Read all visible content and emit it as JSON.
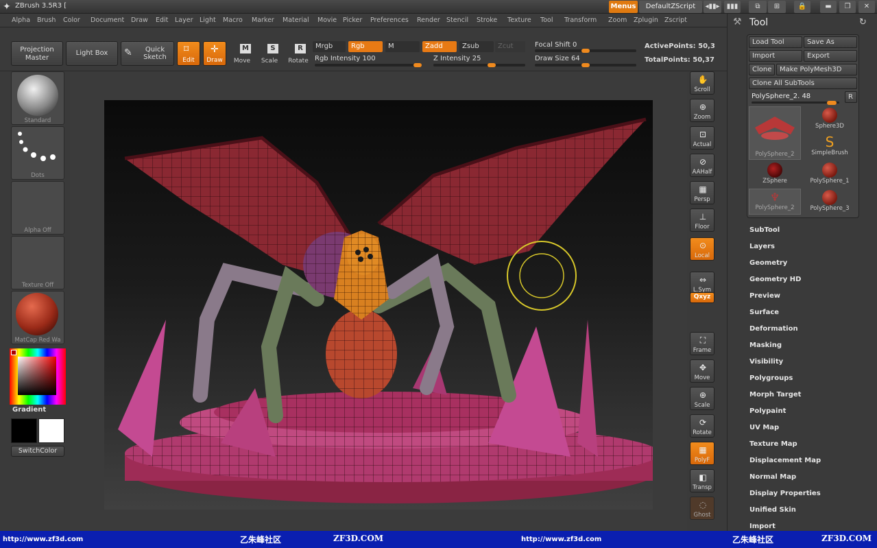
{
  "titlebar": {
    "title": "ZBrush 3.5R3 [",
    "menus_label": "Menus",
    "zscript_label": "DefaultZScript"
  },
  "menubar": {
    "items": [
      "Alpha",
      "Brush",
      "Color",
      "Document",
      "Draw",
      "Edit",
      "Layer",
      "Light",
      "Macro",
      "Marker",
      "Material",
      "Movie",
      "Picker",
      "Preferences",
      "Render",
      "Stencil",
      "Stroke",
      "Texture",
      "Tool",
      "Transform",
      "Zoom",
      "Zplugin",
      "Zscript"
    ]
  },
  "toolbar": {
    "projection_master": "Projection Master",
    "light_box": "Light Box",
    "quick_sketch": "Quick Sketch",
    "edit": "Edit",
    "draw": "Draw",
    "move": "Move",
    "scale": "Scale",
    "rotate": "Rotate",
    "mrgb": "Mrgb",
    "rgb": "Rgb",
    "m": "M",
    "zadd": "Zadd",
    "zsub": "Zsub",
    "zcut": "Zcut",
    "rgb_intensity_label": "Rgb Intensity",
    "rgb_intensity_value": "100",
    "rgb_intensity": 100,
    "z_intensity_label": "Z Intensity",
    "z_intensity_value": "25",
    "z_intensity": 25,
    "focal_shift_label": "Focal Shift",
    "focal_shift_value": "0",
    "draw_size_label": "Draw Size",
    "draw_size_value": "64",
    "active_points": "ActivePoints: 50,3",
    "total_points": "TotalPoints: 50,37"
  },
  "leftshelf": {
    "brush": "Standard",
    "stroke": "Dots",
    "alpha": "Alpha Off",
    "texture": "Texture Off",
    "material": "MatCap Red Wa",
    "gradient": "Gradient",
    "switchcolor": "SwitchColor"
  },
  "rightshelf": {
    "items": [
      {
        "label": "Scroll"
      },
      {
        "label": "Zoom"
      },
      {
        "label": "Actual"
      },
      {
        "label": "AAHalf"
      },
      {
        "label": "Persp"
      },
      {
        "label": "Floor"
      },
      {
        "label": "Local"
      },
      {
        "label": "L.Sym"
      },
      {
        "label": "Frame"
      },
      {
        "label": "Move"
      },
      {
        "label": "Scale"
      },
      {
        "label": "Rotate"
      },
      {
        "label": "PolyF"
      },
      {
        "label": "Transp"
      },
      {
        "label": "Ghost"
      }
    ],
    "xyz": "Qxyz"
  },
  "toolpanel": {
    "title": "Tool",
    "load_tool": "Load Tool",
    "save_as": "Save As",
    "import": "Import",
    "export": "Export",
    "clone": "Clone",
    "make_polymesh": "Make PolyMesh3D",
    "clone_all": "Clone All SubTools",
    "current_tool": "PolySphere_2. 48",
    "r_label": "R",
    "tiles": [
      "PolySphere_2",
      "Sphere3D",
      "SimpleBrush",
      "ZSphere",
      "PolySphere_1",
      "PolySphere_2",
      "PolySphere_3"
    ],
    "subpalettes": [
      "SubTool",
      "Layers",
      "Geometry",
      "Geometry HD",
      "Preview",
      "Surface",
      "Deformation",
      "Masking",
      "Visibility",
      "Polygroups",
      "Morph Target",
      "Polypaint",
      "UV Map",
      "Texture Map",
      "Displacement Map",
      "Normal Map",
      "Display Properties",
      "Unified Skin",
      "Import"
    ]
  },
  "footer": {
    "url1": "http://www.zf3d.com",
    "brand1": "乙朱峰社区",
    "site1": "ZF3D.COM",
    "url2": "http://www.zf3d.com",
    "brand2": "乙朱峰社区",
    "site2": "ZF3D.COM"
  },
  "colors": {
    "accent": "#e87a14",
    "footer_bg": "#0a1fb0",
    "model_primary": "#a8313e",
    "model_base": "#b03a6e"
  }
}
